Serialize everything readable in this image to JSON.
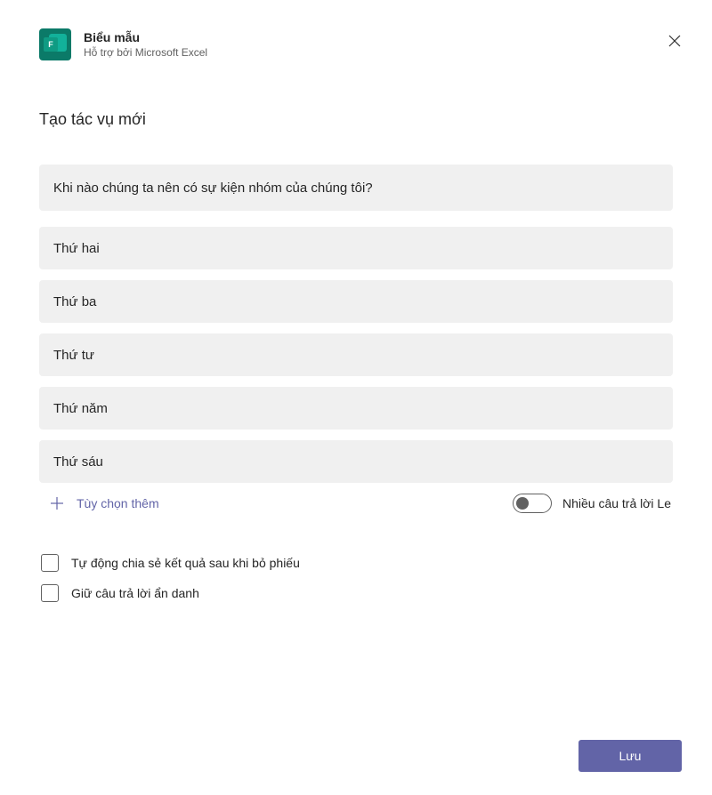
{
  "header": {
    "title": "Biểu mẫu",
    "subtitle": "Hỗ trợ bởi Microsoft Excel"
  },
  "section_title": "Tạo tác vụ mới",
  "question": "Khi nào chúng ta nên có sự kiện nhóm của chúng tôi?",
  "options": [
    "Thứ hai",
    "Thứ ba",
    "Thứ tư",
    "Thứ năm",
    "Thứ sáu"
  ],
  "add_option_label": "Tùy chọn thêm",
  "toggle_label": "Nhiều câu trả lời Le",
  "checkbox_1": "Tự động chia sẻ kết quả sau khi bỏ phiếu",
  "checkbox_2": "Giữ câu trả lời ẩn danh",
  "save_label": "Lưu"
}
